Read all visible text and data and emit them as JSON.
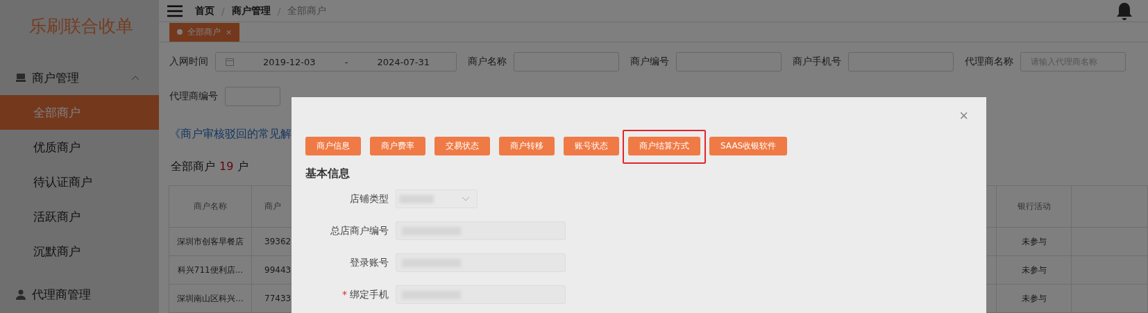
{
  "sidebar": {
    "logo": "乐刷联合收单",
    "menu": [
      {
        "label": "商户管理",
        "expanded": true,
        "children": [
          {
            "label": "全部商户",
            "selected": true
          },
          {
            "label": "优质商户",
            "selected": false
          },
          {
            "label": "待认证商户",
            "selected": false
          },
          {
            "label": "活跃商户",
            "selected": false
          },
          {
            "label": "沉默商户",
            "selected": false
          }
        ]
      },
      {
        "label": "代理商管理"
      }
    ]
  },
  "header": {
    "separator": "/",
    "breadcrumb": [
      {
        "label": "首页",
        "current": false
      },
      {
        "label": "商户管理",
        "current": false
      },
      {
        "label": "全部商户",
        "current": true
      }
    ]
  },
  "tabs": [
    {
      "label": "全部商户",
      "close": "×",
      "selected": true
    }
  ],
  "filters": [
    {
      "kind": "daterange",
      "label": "入网时间",
      "start": "2019-12-03",
      "separator": "-",
      "end": "2024-07-31"
    },
    {
      "kind": "input",
      "label": "商户名称"
    },
    {
      "kind": "input",
      "label": "商户编号"
    },
    {
      "kind": "input",
      "label": "商户手机号"
    },
    {
      "kind": "input",
      "label": "代理商名称",
      "placeholder": "请输入代理商名称"
    },
    {
      "kind": "input",
      "label": "代理商编号"
    }
  ],
  "faq_link": "《商户审核驳回的常见解",
  "summary": {
    "label": "全部商户",
    "count": "19",
    "unit": "户"
  },
  "table": {
    "columns": [
      "商户名称",
      "商户",
      "银行活动"
    ],
    "rows": [
      {
        "name": "深圳市创客早餐店",
        "column_2": "39362",
        "bank_activity": "未参与"
      },
      {
        "name": "科兴711便利店...",
        "column_2": "99443",
        "bank_activity": "未参与"
      },
      {
        "name": "深圳南山区科兴...",
        "column_2": "77433",
        "bank_activity": "未参与"
      }
    ]
  },
  "modal": {
    "close": "×",
    "buttons": [
      {
        "label": "商户信息",
        "highlighted": false
      },
      {
        "label": "商户费率",
        "highlighted": false
      },
      {
        "label": "交易状态",
        "highlighted": false
      },
      {
        "label": "商户转移",
        "highlighted": false
      },
      {
        "label": "账号状态",
        "highlighted": false
      },
      {
        "label": "商户结算方式",
        "highlighted": true
      },
      {
        "label": "SAAS收银软件",
        "highlighted": false
      }
    ],
    "section_title": "基本信息",
    "fields": [
      {
        "kind": "select",
        "label": "店铺类型"
      },
      {
        "kind": "input",
        "label": "总店商户编号"
      },
      {
        "kind": "input",
        "label": "登录账号"
      },
      {
        "kind": "input",
        "label": "绑定手机",
        "required_mark": "*"
      }
    ]
  }
}
